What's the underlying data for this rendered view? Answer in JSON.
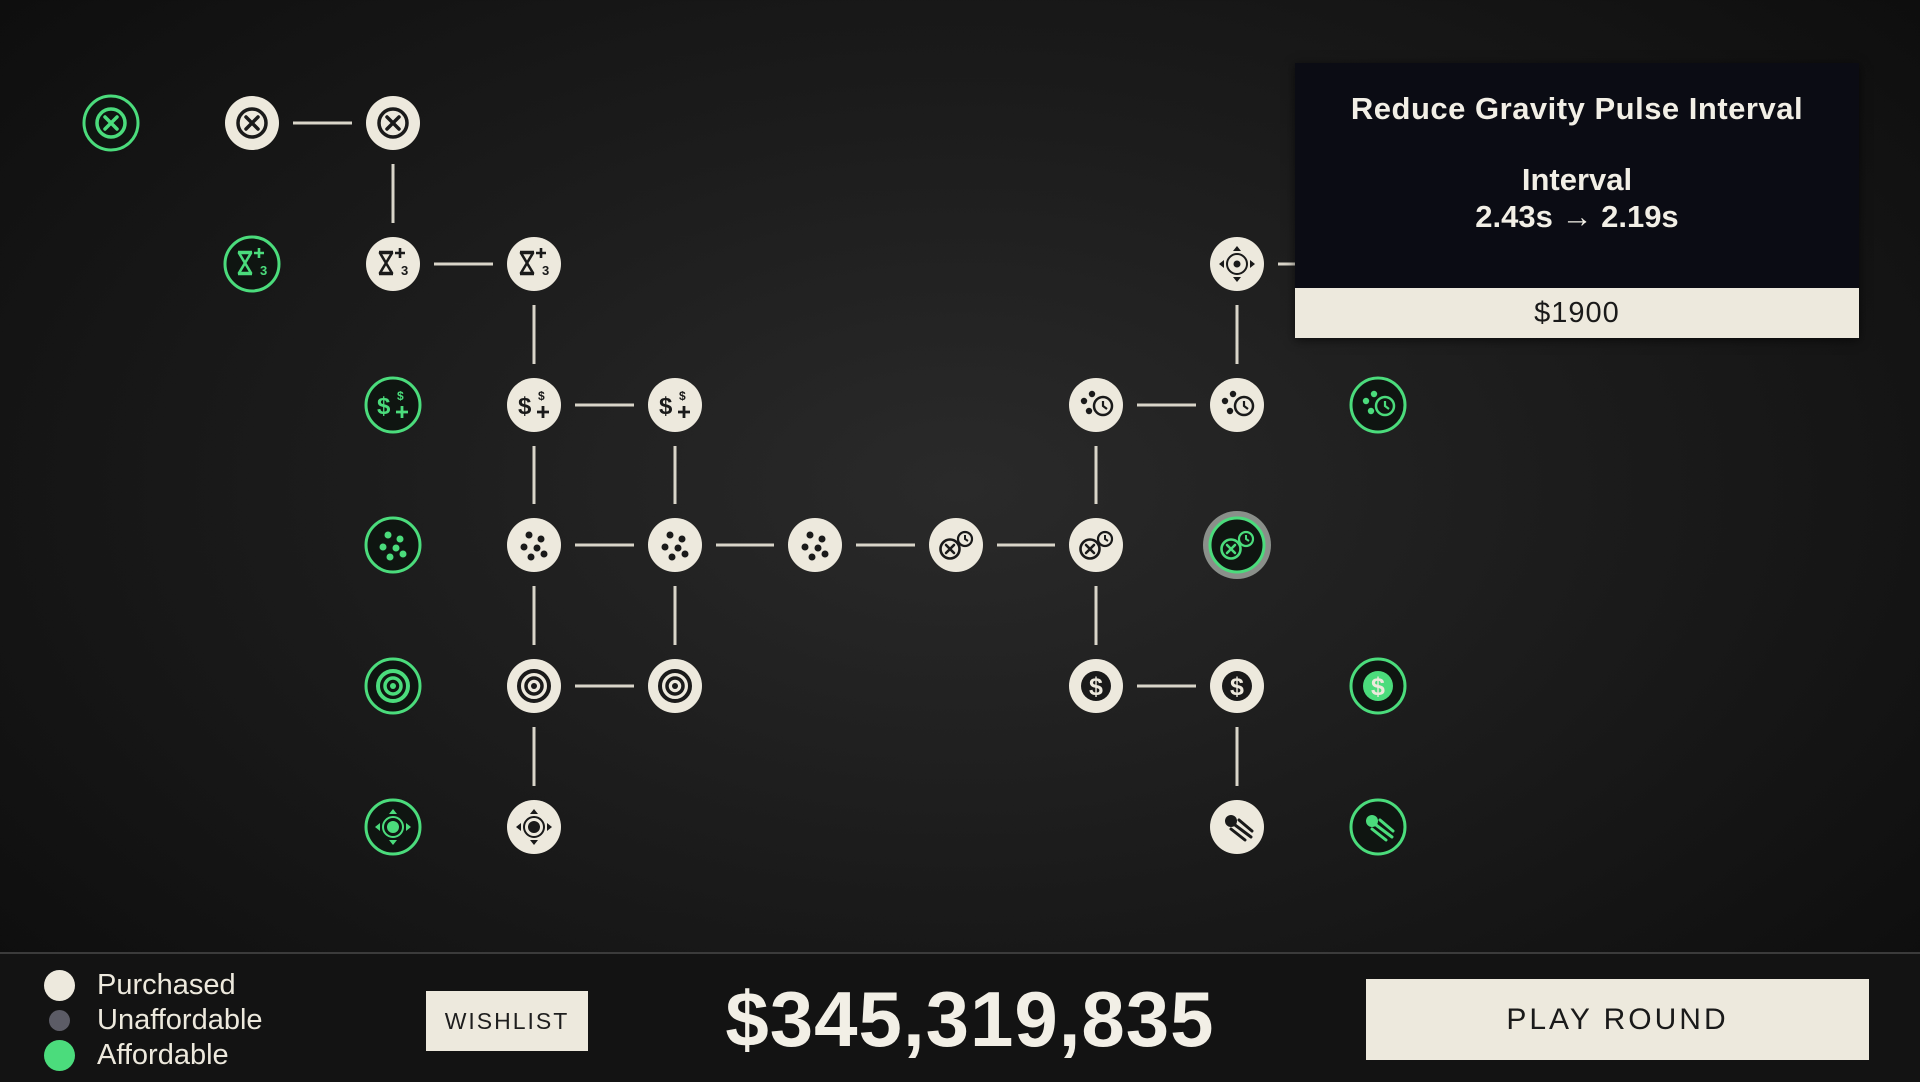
{
  "tooltip": {
    "title": "Reduce Gravity Pulse Interval",
    "stat_label": "Interval",
    "stat_values": "2.43s → 2.19s",
    "cost": "$1900"
  },
  "legend": [
    {
      "label": "Purchased",
      "color": "#ede9dd"
    },
    {
      "label": "Unaffordable",
      "color": "#5c5c66"
    },
    {
      "label": "Affordable",
      "color": "#4bdc7c"
    }
  ],
  "wishlist_label": "WISHLIST",
  "money": "$345,319,835",
  "play_round_label": "PLAY ROUND",
  "colors": {
    "purchased": "#ede9dd",
    "affordable": "#4bdc7c",
    "unaffordable": "#5c5c66",
    "line": "#d9d5c9"
  },
  "skill_tree": {
    "nodes": [
      {
        "id": "n1",
        "icon": "bomb-icon",
        "state": "affordable"
      },
      {
        "id": "n2",
        "icon": "bomb-icon",
        "state": "purchased"
      },
      {
        "id": "n3",
        "icon": "bomb-icon",
        "state": "purchased"
      },
      {
        "id": "n4",
        "icon": "hourglass-plus-icon",
        "state": "affordable"
      },
      {
        "id": "n5",
        "icon": "hourglass-plus-icon",
        "state": "purchased"
      },
      {
        "id": "n6",
        "icon": "hourglass-plus-icon",
        "state": "purchased"
      },
      {
        "id": "n7",
        "icon": "gravity-move-icon",
        "state": "purchased"
      },
      {
        "id": "n8",
        "icon": "money-plus-icon",
        "state": "affordable"
      },
      {
        "id": "n9",
        "icon": "money-plus-icon",
        "state": "purchased"
      },
      {
        "id": "n10",
        "icon": "money-plus-icon",
        "state": "purchased"
      },
      {
        "id": "n11",
        "icon": "orbs-clock-icon",
        "state": "purchased"
      },
      {
        "id": "n12",
        "icon": "orbs-clock-icon",
        "state": "purchased"
      },
      {
        "id": "n13",
        "icon": "orbs-clock-icon",
        "state": "affordable"
      },
      {
        "id": "n14",
        "icon": "dots-icon",
        "state": "affordable"
      },
      {
        "id": "n15",
        "icon": "dots-icon",
        "state": "purchased"
      },
      {
        "id": "n16",
        "icon": "dots-icon",
        "state": "purchased"
      },
      {
        "id": "n17",
        "icon": "dots-icon",
        "state": "purchased"
      },
      {
        "id": "n18",
        "icon": "bomb-clock-icon",
        "state": "purchased"
      },
      {
        "id": "n19",
        "icon": "bomb-clock-icon",
        "state": "purchased"
      },
      {
        "id": "n20",
        "icon": "bomb-clock-icon",
        "state": "affordable"
      },
      {
        "id": "n21",
        "icon": "gravity-ring-icon",
        "state": "affordable"
      },
      {
        "id": "n22",
        "icon": "gravity-ring-icon",
        "state": "purchased"
      },
      {
        "id": "n23",
        "icon": "gravity-ring-icon",
        "state": "purchased"
      },
      {
        "id": "n24",
        "icon": "dollar-icon",
        "state": "purchased"
      },
      {
        "id": "n25",
        "icon": "dollar-icon",
        "state": "purchased"
      },
      {
        "id": "n26",
        "icon": "dollar-icon",
        "state": "affordable"
      },
      {
        "id": "n27",
        "icon": "gravity-range-icon",
        "state": "affordable"
      },
      {
        "id": "n28",
        "icon": "gravity-range-icon",
        "state": "purchased"
      },
      {
        "id": "n29",
        "icon": "comet-icon",
        "state": "purchased"
      },
      {
        "id": "n30",
        "icon": "comet-icon",
        "state": "affordable"
      }
    ],
    "links": [
      [
        "n2",
        "n3"
      ],
      [
        "n3",
        "n5"
      ],
      [
        "n5",
        "n6"
      ],
      [
        "n6",
        "n9"
      ],
      [
        "n9",
        "n10"
      ],
      [
        "n9",
        "n15"
      ],
      [
        "n10",
        "n16"
      ],
      [
        "n15",
        "n16"
      ],
      [
        "n16",
        "n17"
      ],
      [
        "n17",
        "n18"
      ],
      [
        "n18",
        "n19"
      ],
      [
        "n19",
        "n11"
      ],
      [
        "n11",
        "n12"
      ],
      [
        "n12",
        "n7"
      ],
      [
        "n15",
        "n22"
      ],
      [
        "n16",
        "n23"
      ],
      [
        "n22",
        "n23"
      ],
      [
        "n22",
        "n28"
      ],
      [
        "n19",
        "n24"
      ],
      [
        "n24",
        "n25"
      ],
      [
        "n25",
        "n29"
      ],
      [
        "n7",
        "tooltip"
      ]
    ]
  }
}
